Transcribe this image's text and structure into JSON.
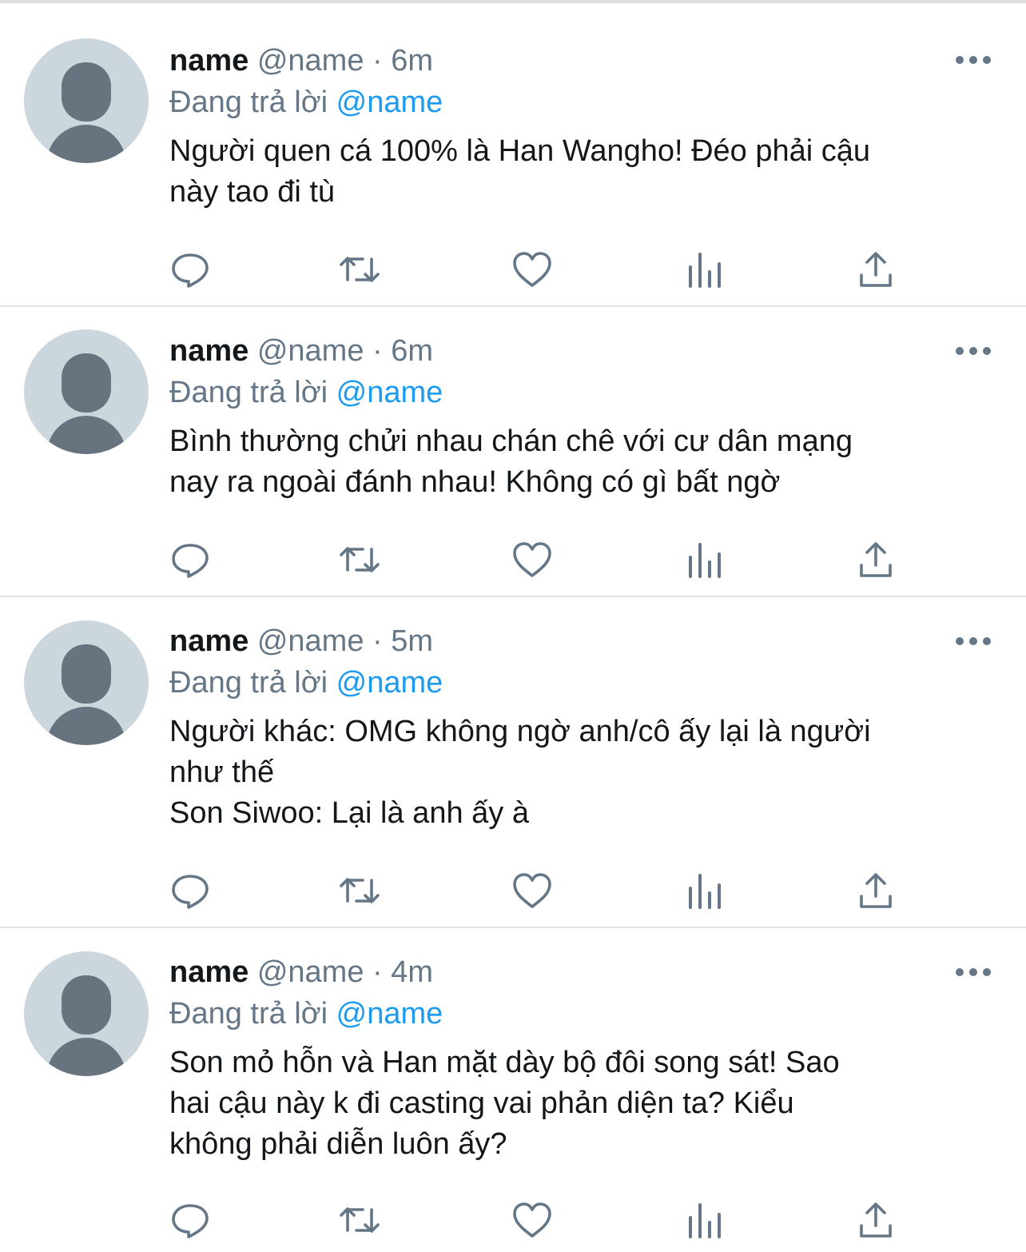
{
  "tweets": [
    {
      "display_name": "name",
      "handle": "@name",
      "separator": "·",
      "time": "6m",
      "reply_prefix": "Đang trả lời",
      "reply_to": "@name",
      "text": "Người quen cá 100% là Han Wangho! Đéo phải cậu\nnày tao đi tù"
    },
    {
      "display_name": "name",
      "handle": "@name",
      "separator": "·",
      "time": "6m",
      "reply_prefix": "Đang trả lời",
      "reply_to": "@name",
      "text": "Bình thường chửi nhau chán chê với cư dân mạng\nnay ra ngoài đánh nhau! Không có gì bất ngờ"
    },
    {
      "display_name": "name",
      "handle": "@name",
      "separator": "·",
      "time": "5m",
      "reply_prefix": "Đang trả lời",
      "reply_to": "@name",
      "text": "Người khác: OMG không ngờ anh/cô ấy lại là người\nnhư thế\nSon Siwoo: Lại là anh ấy à"
    },
    {
      "display_name": "name",
      "handle": "@name",
      "separator": "·",
      "time": "4m",
      "reply_prefix": "Đang trả lời",
      "reply_to": "@name",
      "text": "Son mỏ hỗn và Han mặt dày bộ đôi song sát! Sao\nhai cậu này k đi casting vai phản diện ta? Kiểu\nkhông phải diễn luôn ấy?"
    }
  ],
  "icons": {
    "reply": "speech-bubble-icon",
    "retweet": "retweet-icon",
    "like": "heart-icon",
    "analytics": "bar-chart-icon",
    "share": "share-upload-icon",
    "more": "ellipsis-icon"
  },
  "colors": {
    "link": "#1d9bf0",
    "secondary": "#657786",
    "avatar_bg": "#ccd6dd",
    "avatar_fg": "#67747f",
    "divider": "#e2e5e8"
  }
}
